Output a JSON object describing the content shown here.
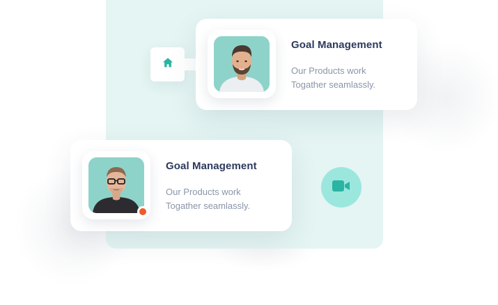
{
  "cards": [
    {
      "title": "Goal Management",
      "description_line1": "Our Products work",
      "description_line2": "Togather seamlassly.",
      "avatar": "man-with-beard-avatar"
    },
    {
      "title": "Goal Management",
      "description_line1": "Our Products work",
      "description_line2": "Togather seamlassly.",
      "avatar": "man-with-glasses-avatar",
      "status": "online-dot"
    }
  ],
  "icons": {
    "home": "home-icon",
    "video": "video-camera-icon"
  },
  "colors": {
    "accent": "#2bb3a3",
    "panel": "#e4f5f3",
    "title": "#2d3a5d",
    "text": "#8a95a8",
    "status": "#ee5a2a",
    "video_bg": "#9be7dd"
  }
}
